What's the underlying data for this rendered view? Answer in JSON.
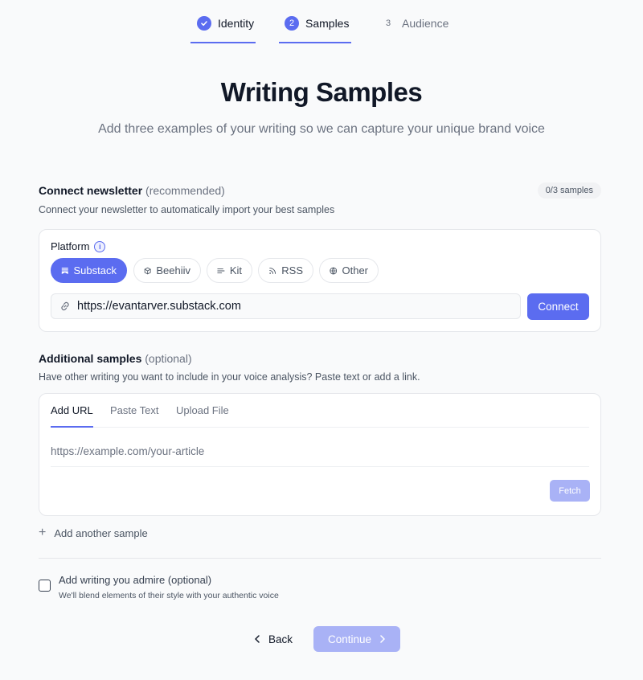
{
  "stepper": {
    "steps": [
      {
        "num": "✓",
        "label": "Identity",
        "state": "done"
      },
      {
        "num": "2",
        "label": "Samples",
        "state": "active"
      },
      {
        "num": "3",
        "label": "Audience",
        "state": "pending"
      }
    ]
  },
  "header": {
    "title": "Writing Samples",
    "subtitle": "Add three examples of your writing so we can capture your unique brand voice"
  },
  "newsletter": {
    "title": "Connect newsletter",
    "title_suffix": "(recommended)",
    "description": "Connect your newsletter to automatically import your best samples",
    "count_badge": "0/3 samples",
    "platform_label": "Platform",
    "info_icon": "i",
    "platforms": [
      {
        "label": "Substack",
        "icon": "substack-icon",
        "active": true
      },
      {
        "label": "Beehiiv",
        "icon": "cube-icon",
        "active": false
      },
      {
        "label": "Kit",
        "icon": "lines-icon",
        "active": false
      },
      {
        "label": "RSS",
        "icon": "rss-icon",
        "active": false
      },
      {
        "label": "Other",
        "icon": "globe-icon",
        "active": false
      }
    ],
    "url_value": "https://evantarver.substack.com",
    "connect_label": "Connect"
  },
  "additional": {
    "title": "Additional samples",
    "title_suffix": "(optional)",
    "description": "Have other writing you want to include in your voice analysis? Paste text or add a link.",
    "tabs": [
      "Add URL",
      "Paste Text",
      "Upload File"
    ],
    "input_placeholder": "https://example.com/your-article",
    "fetch_label": "Fetch",
    "add_another_label": "Add another sample"
  },
  "admire": {
    "title": "Add writing you admire (optional)",
    "description": "We'll blend elements of their style with your authentic voice"
  },
  "footer": {
    "back_label": "Back",
    "continue_label": "Continue"
  },
  "colors": {
    "accent": "#5b6cf0",
    "accent_disabled": "#a9b2f6"
  }
}
